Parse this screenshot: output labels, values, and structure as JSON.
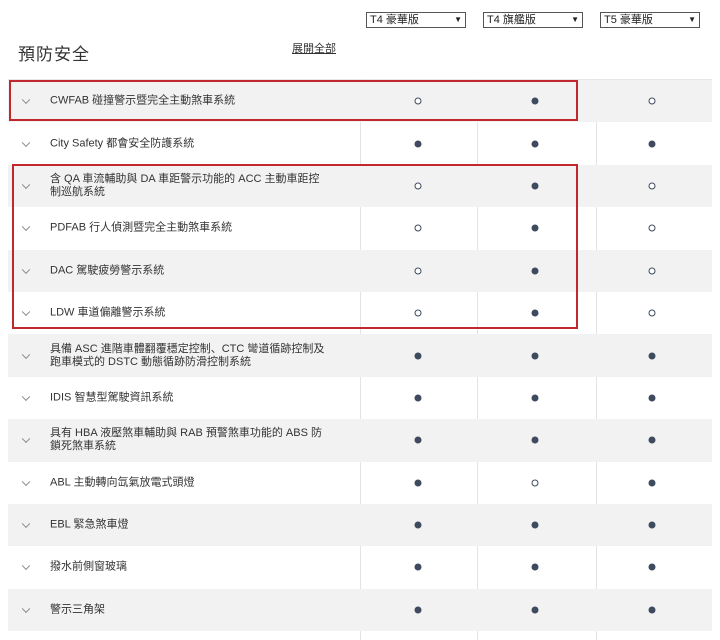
{
  "selectors": [
    {
      "label": "T4 豪華版"
    },
    {
      "label": "T4 旗艦版"
    },
    {
      "label": "T5 豪華版"
    }
  ],
  "section_title": "預防安全",
  "expand_all": "展開全部",
  "rows": [
    {
      "label": "CWFAB 碰撞警示暨完全主動煞車系統",
      "values": [
        "hollow",
        "filled",
        "hollow"
      ]
    },
    {
      "label": "City Safety 都會安全防護系統",
      "values": [
        "filled",
        "filled",
        "filled"
      ]
    },
    {
      "label": "含 QA 車流輔助與 DA 車距警示功能的 ACC 主動車距控制巡航系統",
      "values": [
        "hollow",
        "filled",
        "hollow"
      ]
    },
    {
      "label": "PDFAB 行人偵測暨完全主動煞車系統",
      "values": [
        "hollow",
        "filled",
        "hollow"
      ]
    },
    {
      "label": "DAC 駕駛疲勞警示系統",
      "values": [
        "hollow",
        "filled",
        "hollow"
      ]
    },
    {
      "label": "LDW 車道偏離警示系統",
      "values": [
        "hollow",
        "filled",
        "hollow"
      ]
    },
    {
      "label": "具備 ASC 進階車體翻覆穩定控制、CTC 彎道循跡控制及跑車模式的 DSTC 動態循跡防滑控制系統",
      "values": [
        "filled",
        "filled",
        "filled"
      ]
    },
    {
      "label": "IDIS 智慧型駕駛資訊系統",
      "values": [
        "filled",
        "filled",
        "filled"
      ]
    },
    {
      "label": "具有 HBA 液壓煞車輔助與 RAB 預警煞車功能的 ABS 防鎖死煞車系統",
      "values": [
        "filled",
        "filled",
        "filled"
      ]
    },
    {
      "label": "ABL 主動轉向氙氣放電式頭燈",
      "values": [
        "filled",
        "hollow",
        "filled"
      ]
    },
    {
      "label": "EBL 緊急煞車燈",
      "values": [
        "filled",
        "filled",
        "filled"
      ]
    },
    {
      "label": "撥水前側窗玻璃",
      "values": [
        "filled",
        "filled",
        "filled"
      ]
    },
    {
      "label": "警示三角架",
      "values": [
        "filled",
        "filled",
        "filled"
      ]
    }
  ],
  "colors": {
    "dot": "#3e4a5e",
    "highlight_border": "#c0282e",
    "row_shade": "#f2f2f2"
  }
}
